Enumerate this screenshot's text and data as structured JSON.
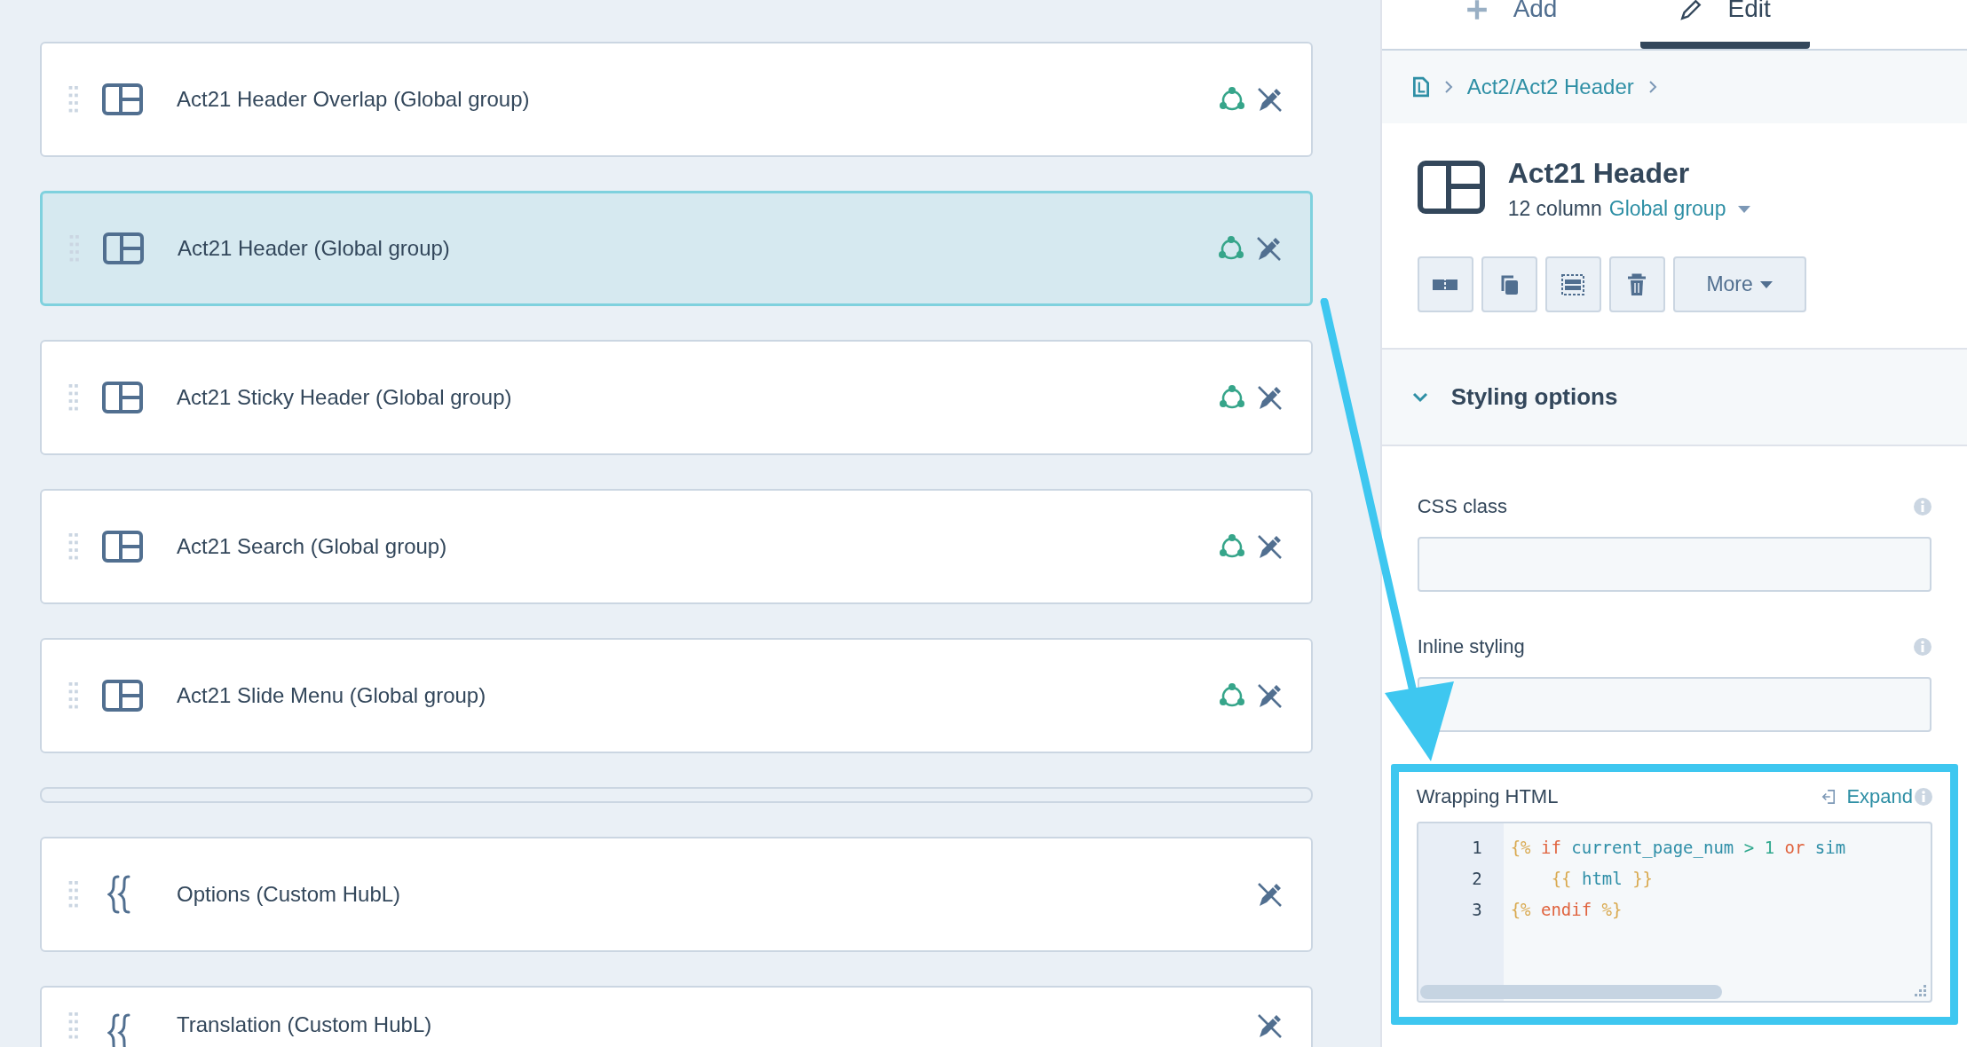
{
  "tabs": [
    {
      "label": "Add",
      "kind": "add",
      "selected": false
    },
    {
      "label": "Edit",
      "kind": "edit",
      "selected": true
    }
  ],
  "breadcrumb": {
    "link": "Act2/Act2 Header"
  },
  "modules": [
    {
      "label": "Act21 Header Overlap (Global group)",
      "kind": "layout",
      "selected": false,
      "global": true
    },
    {
      "label": "Act21 Header (Global group)",
      "kind": "layout",
      "selected": true,
      "global": true
    },
    {
      "label": "Act21 Sticky Header (Global group)",
      "kind": "layout",
      "selected": false,
      "global": true
    },
    {
      "label": "Act21 Search (Global group)",
      "kind": "layout",
      "selected": false,
      "global": true
    },
    {
      "label": "Act21 Slide Menu (Global group)",
      "kind": "layout",
      "selected": false,
      "global": true
    },
    {
      "kind": "empty"
    },
    {
      "label": "Options (Custom HubL)",
      "kind": "hubl",
      "selected": false,
      "global": false
    },
    {
      "label": "Translation (Custom HubL)",
      "kind": "hubl",
      "selected": false,
      "global": false
    }
  ],
  "module_header": {
    "title": "Act21 Header",
    "columns": "12 column",
    "group_link": "Global group",
    "more_button": "More"
  },
  "section": {
    "title": "Styling options",
    "expanded": true
  },
  "fields": [
    {
      "label": "CSS class"
    },
    {
      "label": "Inline styling"
    }
  ],
  "wrapping_html": {
    "label": "Wrapping HTML",
    "expand": "Expand",
    "lines": [
      {
        "number": "1",
        "indent": false,
        "tokens": [
          {
            "text": "{%",
            "kind": "delim"
          },
          {
            "text": "if",
            "kind": "keyword"
          },
          {
            "text": "current_page_num",
            "kind": "var"
          },
          {
            "text": ">",
            "kind": "op"
          },
          {
            "text": "1",
            "kind": "op"
          },
          {
            "text": "or",
            "kind": "keyword"
          },
          {
            "text": "sim",
            "kind": "var"
          }
        ]
      },
      {
        "number": "2",
        "indent": true,
        "tokens": [
          {
            "text": "{{",
            "kind": "delim"
          },
          {
            "text": "html",
            "kind": "var"
          },
          {
            "text": "}}",
            "kind": "delim"
          }
        ]
      },
      {
        "number": "3",
        "indent": false,
        "tokens": [
          {
            "text": "{%",
            "kind": "delim"
          },
          {
            "text": "endif",
            "kind": "keyword"
          },
          {
            "text": "%}",
            "kind": "delim"
          }
        ]
      }
    ]
  }
}
